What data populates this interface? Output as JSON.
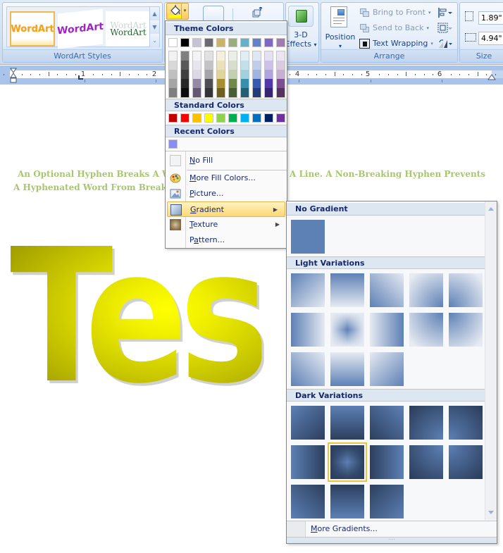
{
  "ribbon": {
    "wordart_styles": {
      "label": "WordArt Styles",
      "thumbnails": [
        {
          "name": "wordart-orange",
          "text": "WordArt",
          "selected": true
        },
        {
          "name": "wordart-purple",
          "text": "WordArt",
          "selected": false
        },
        {
          "name": "wordart-serif-green",
          "text": "WordArt",
          "ghost_text": "WordArt",
          "selected": false
        }
      ],
      "scroll_up": "▲",
      "scroll_down": "▼",
      "more": "⌄"
    },
    "shape_fill": {
      "fill_color": "#ffff00",
      "arrow": "▾"
    },
    "effects_3d": {
      "line1": "3-D",
      "line2": "Effects",
      "arrow": "▾"
    },
    "arrange": {
      "label": "Arrange",
      "position_label": "Position",
      "position_arrow": "▾",
      "bring_to_front": "Bring to Front",
      "send_to_back": "Send to Back",
      "text_wrapping": "Text Wrapping",
      "dropdown_arrow": "▾"
    },
    "size": {
      "label": "Size",
      "height": "1.89\"",
      "width": "4.94\""
    }
  },
  "ruler": {
    "numbers": [
      "1",
      "2",
      "4",
      "5",
      "6"
    ]
  },
  "document": {
    "line1_left": "An Optional Hyphen Breaks A W",
    "line1_right": "A Line. A Non-Breaking Hyphen Prevents",
    "line2_left": "A Hyphenated  Word From Breaki",
    "wordart_text": "Tes",
    "text_color": "#9bbb59"
  },
  "color_menu": {
    "theme_colors_label": "Theme Colors",
    "theme_top_row": [
      "#ffffff",
      "#000000",
      "#c8c3d3",
      "#6b6a70",
      "#cbb467",
      "#9aae7c",
      "#65b1c9",
      "#5f82ca",
      "#7e68c2",
      "#a17ab4"
    ],
    "theme_shades": [
      [
        "#f2f2f2",
        "#d8d8d8",
        "#bfbfbf",
        "#a5a5a5",
        "#7f7f7f"
      ],
      [
        "#7f7f7f",
        "#595959",
        "#3f3f3f",
        "#262626",
        "#0c0c0c"
      ],
      [
        "#f4f3f6",
        "#e8e6ed",
        "#dcd9e4",
        "#958aa4",
        "#645972"
      ],
      [
        "#e1e1e2",
        "#c3c3c5",
        "#a5a4a8",
        "#4f4e53",
        "#353438"
      ],
      [
        "#f5f0de",
        "#ebe1bd",
        "#e1d39c",
        "#a68e35",
        "#6f5e23"
      ],
      [
        "#ebefe5",
        "#d7dfcb",
        "#c3cfb1",
        "#708a4b",
        "#4a5c32"
      ],
      [
        "#e0eff4",
        "#c1e0ea",
        "#a2d0df",
        "#388fab",
        "#255f72"
      ],
      [
        "#dfe6f4",
        "#bfcdea",
        "#9fb4df",
        "#345ab2",
        "#233c77"
      ],
      [
        "#e5e0f2",
        "#cbc2e6",
        "#b1a4da",
        "#5239a6",
        "#36266e"
      ],
      [
        "#ece4f0",
        "#d9c9e1",
        "#c6afd2",
        "#7d4c94",
        "#533262"
      ]
    ],
    "standard_colors_label": "Standard Colors",
    "standard_colors": [
      "#c00000",
      "#ff0000",
      "#ffc000",
      "#ffff00",
      "#92d050",
      "#00b050",
      "#00b0f0",
      "#0070c0",
      "#002060",
      "#7030a0"
    ],
    "recent_colors_label": "Recent Colors",
    "recent_colors": [
      "#8a8ef0"
    ],
    "items": [
      {
        "label": "No Fill",
        "mnemonic": "N",
        "rest": "o Fill",
        "icon": "no-fill-icon",
        "submenu": false
      },
      {
        "label": "More Fill Colors...",
        "mnemonic": "M",
        "rest": "ore Fill Colors...",
        "icon": "palette-icon",
        "submenu": false
      },
      {
        "label": "Picture...",
        "mnemonic": "P",
        "rest": "icture...",
        "icon": "picture-icon",
        "submenu": false
      },
      {
        "label": "Gradient",
        "mnemonic": "G",
        "rest": "radient",
        "icon": "gradient-icon",
        "submenu": true,
        "highlighted": true
      },
      {
        "label": "Texture",
        "mnemonic": "T",
        "rest": "exture",
        "icon": "texture-icon",
        "submenu": true
      },
      {
        "label": "Pattern...",
        "pre": "P",
        "mnemonic": "a",
        "rest": "ttern...",
        "icon": "",
        "submenu": false
      }
    ],
    "submenu_arrow": "▶"
  },
  "gradient_gallery": {
    "no_gradient_label": "No Gradient",
    "base_color": "#5d80b5",
    "light_variations_label": "Light Variations",
    "light_variations": [
      "linear-gradient(to bottom right, #5d80b5, #e6eaf2)",
      "linear-gradient(to bottom, #5d80b5, #e6eaf2)",
      "linear-gradient(to bottom left, #e6eaf2 0%, #5d80b5 100%) ",
      "radial-gradient(circle at 100% 100%, #5d80b5, #e6eaf2 90%)",
      "radial-gradient(circle at 0% 100%, #5d80b5, #e6eaf2 90%)",
      "linear-gradient(to right, #5d80b5, #e6eaf2)",
      "center",
      "linear-gradient(to right, #e6eaf2, #5d80b5)",
      "radial-gradient(circle at 100% 0%, #5d80b5, #e6eaf2 90%)",
      "radial-gradient(circle at 0% 0%, #5d80b5, #e6eaf2 90%)",
      "linear-gradient(to top right, #5d80b5, #e6eaf2)",
      "linear-gradient(to top, #5d80b5, #e6eaf2)",
      "linear-gradient(to top left, #5d80b5, #e6eaf2)"
    ],
    "dark_variations_label": "Dark Variations",
    "dark_variations": [
      "linear-gradient(to bottom right, #5d80b5, #2c3f5e)",
      "linear-gradient(to bottom, #5d80b5, #2c3f5e)",
      "linear-gradient(to bottom left, #5d80b5, #2c3f5e)",
      "radial-gradient(circle at 100% 100%, #5d80b5, #2c3f5e 95%)",
      "radial-gradient(circle at 0% 100%, #5d80b5, #2c3f5e 95%)",
      "linear-gradient(to right, #5d80b5, #2c3f5e)",
      "center-dark",
      "linear-gradient(to right, #2c3f5e, #5d80b5)",
      "radial-gradient(circle at 100% 0%, #5d80b5, #2c3f5e 95%)",
      "radial-gradient(circle at 0% 0%, #5d80b5, #2c3f5e 95%)",
      "linear-gradient(to top right, #5d80b5, #2c3f5e)",
      "linear-gradient(to top, #5d80b5, #2c3f5e)",
      "linear-gradient(to top left, #5d80b5, #2c3f5e)"
    ],
    "selected_dark_index": 6,
    "more_gradients": {
      "mnemonic": "M",
      "rest": "ore Gradients..."
    },
    "grip": "····"
  }
}
